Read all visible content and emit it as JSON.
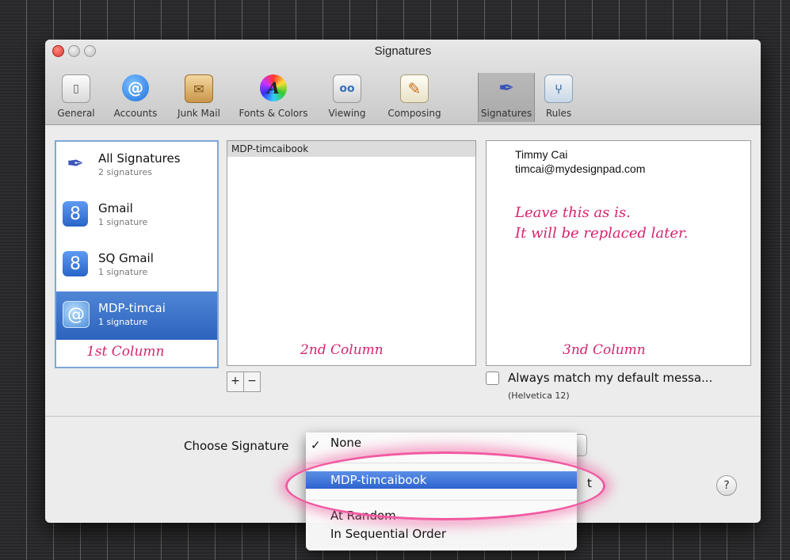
{
  "window": {
    "title": "Signatures"
  },
  "toolbar": {
    "items": [
      {
        "label": "General",
        "icon": "general-switch-icon"
      },
      {
        "label": "Accounts",
        "icon": "at-sign-icon"
      },
      {
        "label": "Junk Mail",
        "icon": "junk-bag-icon"
      },
      {
        "label": "Fonts & Colors",
        "icon": "fonts-colors-icon"
      },
      {
        "label": "Viewing",
        "icon": "viewing-icon"
      },
      {
        "label": "Composing",
        "icon": "pencil-icon"
      },
      {
        "label": "Signatures",
        "icon": "signature-pen-icon"
      },
      {
        "label": "Rules",
        "icon": "rules-icon"
      }
    ],
    "selected": "Signatures"
  },
  "accounts": [
    {
      "name": "All Signatures",
      "sub": "2 signatures",
      "icon": "signature-pen-icon"
    },
    {
      "name": "Gmail",
      "sub": "1 signature",
      "icon": "google-g-icon"
    },
    {
      "name": "SQ Gmail",
      "sub": "1 signature",
      "icon": "google-g-icon"
    },
    {
      "name": "MDP-timcai",
      "sub": "1 signature",
      "icon": "at-sign-icon"
    }
  ],
  "signatures": {
    "items": [
      "MDP-timcaibook"
    ]
  },
  "preview": {
    "name": "Timmy Cai",
    "email": "timcai@mydesignpad.com",
    "note_line1": "Leave this as is.",
    "note_line2": "It will be replaced later."
  },
  "annotations": {
    "col1": "1st Column",
    "col2": "2nd Column",
    "col3": "3nd Column"
  },
  "controls": {
    "add": "+",
    "remove": "−",
    "match_label": "Always match my default messa...",
    "match_font": "(Helvetica 12)",
    "choose_label": "Choose Signature",
    "help": "?"
  },
  "dropdown": {
    "checked": "None",
    "highlighted": "MDP-timcaibook",
    "options": [
      "None",
      "MDP-timcaibook",
      "At Random",
      "In Sequential Order"
    ],
    "partial_text": "t"
  },
  "colors": {
    "annotation": "#d6246e",
    "highlight": "#2e63cf",
    "halo": "#f05aa0"
  }
}
